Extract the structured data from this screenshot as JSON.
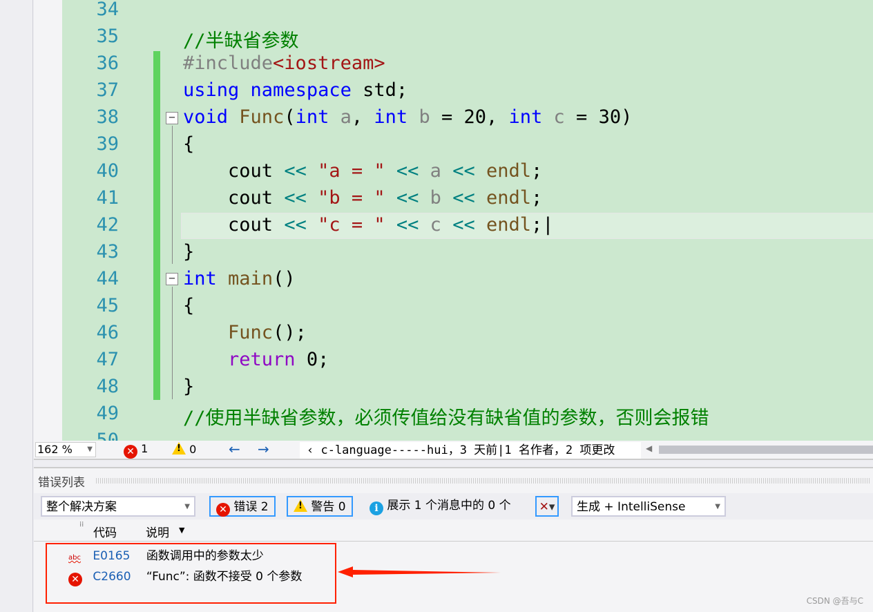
{
  "editor": {
    "lines": [
      {
        "num": "34",
        "tokens": []
      },
      {
        "num": "35",
        "tokens": [
          {
            "t": "//半缺省参数",
            "c": "c"
          }
        ]
      },
      {
        "num": "36",
        "tokens": [
          {
            "t": "#include",
            "c": "i"
          },
          {
            "t": "<iostream>",
            "c": "s"
          }
        ]
      },
      {
        "num": "37",
        "tokens": [
          {
            "t": "using",
            "c": "k"
          },
          {
            "t": " ",
            "c": "n"
          },
          {
            "t": "namespace",
            "c": "k"
          },
          {
            "t": " std;",
            "c": "n"
          }
        ]
      },
      {
        "num": "38",
        "tokens": [
          {
            "t": "void",
            "c": "k"
          },
          {
            "t": " ",
            "c": "n"
          },
          {
            "t": "Func",
            "c": "f"
          },
          {
            "t": "(",
            "c": "n"
          },
          {
            "t": "int",
            "c": "k"
          },
          {
            "t": " a",
            "c": "p"
          },
          {
            "t": ", ",
            "c": "n"
          },
          {
            "t": "int",
            "c": "k"
          },
          {
            "t": " b",
            "c": "p"
          },
          {
            "t": " = 20, ",
            "c": "n"
          },
          {
            "t": "int",
            "c": "k"
          },
          {
            "t": " c",
            "c": "p"
          },
          {
            "t": " = 30)",
            "c": "n"
          }
        ]
      },
      {
        "num": "39",
        "tokens": [
          {
            "t": "{",
            "c": "n"
          }
        ]
      },
      {
        "num": "40",
        "tokens": [
          {
            "t": "    cout ",
            "c": "n"
          },
          {
            "t": "<<",
            "c": "o"
          },
          {
            "t": " \"a = \"",
            "c": "s"
          },
          {
            "t": " ",
            "c": "n"
          },
          {
            "t": "<<",
            "c": "o"
          },
          {
            "t": " a ",
            "c": "p"
          },
          {
            "t": "<<",
            "c": "o"
          },
          {
            "t": " endl",
            "c": "f"
          },
          {
            "t": ";",
            "c": "n"
          }
        ]
      },
      {
        "num": "41",
        "tokens": [
          {
            "t": "    cout ",
            "c": "n"
          },
          {
            "t": "<<",
            "c": "o"
          },
          {
            "t": " \"b = \"",
            "c": "s"
          },
          {
            "t": " ",
            "c": "n"
          },
          {
            "t": "<<",
            "c": "o"
          },
          {
            "t": " b ",
            "c": "p"
          },
          {
            "t": "<<",
            "c": "o"
          },
          {
            "t": " endl",
            "c": "f"
          },
          {
            "t": ";",
            "c": "n"
          }
        ]
      },
      {
        "num": "42",
        "tokens": [
          {
            "t": "    cout ",
            "c": "n"
          },
          {
            "t": "<<",
            "c": "o"
          },
          {
            "t": " \"c = \"",
            "c": "s"
          },
          {
            "t": " ",
            "c": "n"
          },
          {
            "t": "<<",
            "c": "o"
          },
          {
            "t": " c ",
            "c": "p"
          },
          {
            "t": "<<",
            "c": "o"
          },
          {
            "t": " endl",
            "c": "f"
          },
          {
            "t": ";|",
            "c": "n"
          }
        ]
      },
      {
        "num": "43",
        "tokens": [
          {
            "t": "}",
            "c": "n"
          }
        ]
      },
      {
        "num": "44",
        "tokens": [
          {
            "t": "int",
            "c": "k"
          },
          {
            "t": " ",
            "c": "n"
          },
          {
            "t": "main",
            "c": "f"
          },
          {
            "t": "()",
            "c": "n"
          }
        ]
      },
      {
        "num": "45",
        "tokens": [
          {
            "t": "{",
            "c": "n"
          }
        ]
      },
      {
        "num": "46",
        "tokens": [
          {
            "t": "    ",
            "c": "n"
          },
          {
            "t": "Func",
            "c": "f"
          },
          {
            "t": "();",
            "c": "n"
          }
        ]
      },
      {
        "num": "47",
        "tokens": [
          {
            "t": "    ",
            "c": "n"
          },
          {
            "t": "return",
            "c": "r"
          },
          {
            "t": " 0;",
            "c": "n"
          }
        ]
      },
      {
        "num": "48",
        "tokens": [
          {
            "t": "}",
            "c": "n"
          }
        ]
      },
      {
        "num": "49",
        "tokens": [
          {
            "t": "//使用半缺省参数，必须传值给没有缺省值的参数，否则会报错",
            "c": "c"
          }
        ]
      },
      {
        "num": "50",
        "tokens": []
      }
    ]
  },
  "status": {
    "zoom": "162 %",
    "errors": "1",
    "warnings": "0",
    "git": "‹ c-language-----hui，3 天前|1 名作者，2 项更改"
  },
  "error_list": {
    "title": "错误列表",
    "scope": "整个解决方案",
    "errors_btn": "错误 2",
    "warnings_btn": "警告 0",
    "messages_btn": "展示 1 个消息中的 0 个",
    "source": "生成 + IntelliSense",
    "columns": [
      "代码",
      "说明"
    ],
    "rows": [
      {
        "icon": "spell-abc-icon",
        "code": "E0165",
        "desc": "函数调用中的参数太少"
      },
      {
        "icon": "error-icon",
        "code": "C2660",
        "desc": "“Func”: 函数不接受 0 个参数"
      }
    ]
  },
  "watermark": "CSDN @吾与C",
  "colors": {
    "annotation": "#ff2000",
    "editor_bg": "#cce8cf"
  }
}
